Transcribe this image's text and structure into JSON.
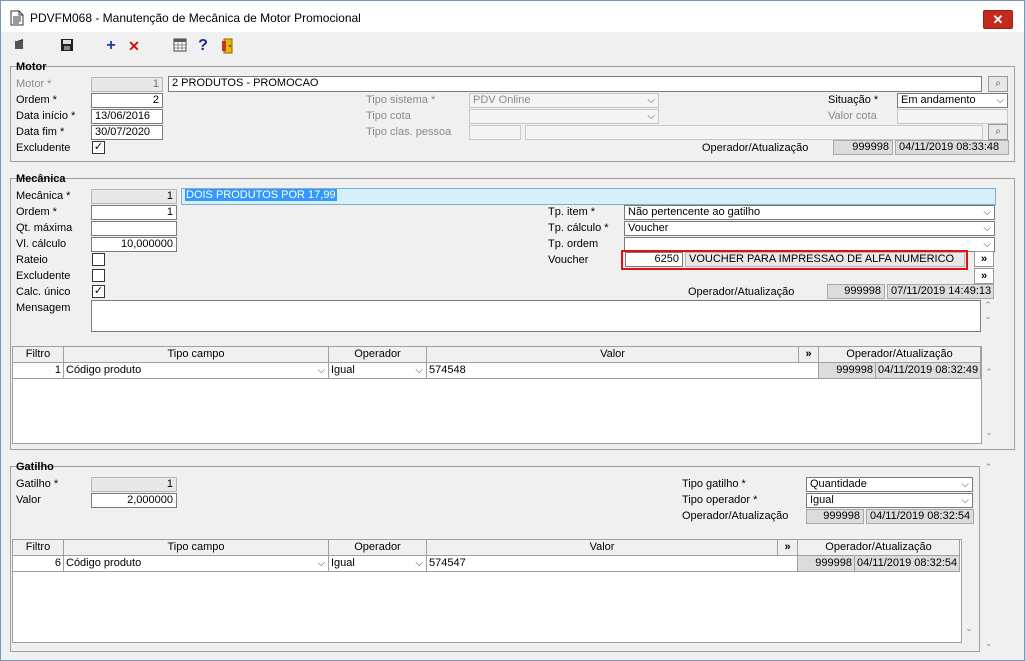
{
  "window": {
    "title": "PDVFM068 - Manutenção de Mecânica de Motor Promocional",
    "close_glyph": "✕"
  },
  "toolbar": {
    "icons": [
      "first-record-icon",
      "save-icon",
      "add-icon",
      "delete-icon",
      "calendar-grid-icon",
      "help-icon",
      "exit-door-icon"
    ],
    "add_glyph": "+",
    "delete_glyph": "✕",
    "help_glyph": "?"
  },
  "motor": {
    "section_title": "Motor",
    "motor_label": "Motor *",
    "motor_code": "1",
    "motor_desc": "2 PRODUTOS - PROMOCAO",
    "ordem_label": "Ordem *",
    "ordem_value": "2",
    "data_inicio_label": "Data início *",
    "data_inicio_value": "13/06/2016",
    "data_fim_label": "Data fim *",
    "data_fim_value": "30/07/2020",
    "excludente_label": "Excludente",
    "excludente_checked": "✓",
    "tipo_sistema_label": "Tipo sistema *",
    "tipo_sistema_value": "PDV Online",
    "tipo_cota_label": "Tipo cota",
    "tipo_cota_value": "",
    "tipo_clas_label": "Tipo clas. pessoa",
    "situacao_label": "Situação *",
    "situacao_value": "Em andamento",
    "valor_cota_label": "Valor cota",
    "operador_label": "Operador/Atualização",
    "operador_code": "999998",
    "operador_date": "04/11/2019 08:33:48"
  },
  "mecanica": {
    "section_title": "Mecânica",
    "mecanica_label": "Mecânica *",
    "mecanica_code": "1",
    "mecanica_desc": "DOIS PRODUTOS POR 17,99",
    "ordem_label": "Ordem *",
    "ordem_value": "1",
    "qt_maxima_label": "Qt. máxima",
    "qt_maxima_value": "",
    "vl_calculo_label": "Vl. cálculo",
    "vl_calculo_value": "10,000000",
    "rateio_label": "Rateio",
    "excludente_label": "Excludente",
    "calc_unico_label": "Calc. único",
    "calc_unico_checked": "✓",
    "mensagem_label": "Mensagem",
    "mensagem_value": "",
    "tp_item_label": "Tp. item *",
    "tp_item_value": "Não pertencente ao gatilho",
    "tp_calculo_label": "Tp. cálculo *",
    "tp_calculo_value": "Voucher",
    "tp_ordem_label": "Tp. ordem",
    "tp_ordem_value": "",
    "voucher_label": "Voucher",
    "voucher_code": "6250",
    "voucher_desc": "VOUCHER PARA IMPRESSAO DE ALFA NUMERICO",
    "operador_label": "Operador/Atualização",
    "operador_code": "999998",
    "operador_date": "07/11/2019 14:49:13",
    "more_glyph": "»"
  },
  "mecanica_grid": {
    "headers": [
      "Filtro",
      "Tipo campo",
      "Operador",
      "Valor",
      "»",
      "Operador/Atualização"
    ],
    "rows": [
      {
        "filtro": "1",
        "tipo_campo": "Código produto",
        "operador": "Igual",
        "valor": "574548",
        "op_code": "999998",
        "op_date": "04/11/2019 08:32:49"
      }
    ]
  },
  "gatilho": {
    "section_title": "Gatilho",
    "gatilho_label": "Gatilho *",
    "gatilho_code": "1",
    "valor_label": "Valor",
    "valor_value": "2,000000",
    "tipo_gatilho_label": "Tipo gatilho *",
    "tipo_gatilho_value": "Quantidade",
    "tipo_operador_label": "Tipo operador *",
    "tipo_operador_value": "Igual",
    "operador_label": "Operador/Atualização",
    "operador_code": "999998",
    "operador_date": "04/11/2019 08:32:54"
  },
  "gatilho_grid": {
    "headers": [
      "Filtro",
      "Tipo campo",
      "Operador",
      "Valor",
      "»",
      "Operador/Atualização"
    ],
    "rows": [
      {
        "filtro": "6",
        "tipo_campo": "Código produto",
        "operador": "Igual",
        "valor": "574547",
        "op_code": "999998",
        "op_date": "04/11/2019 08:32:54"
      }
    ]
  },
  "colors": {
    "close_red": "#c42b1c",
    "highlight_blue": "#3399ff",
    "selected_field": "#d4f1fb",
    "voucher_border": "#e01010"
  }
}
